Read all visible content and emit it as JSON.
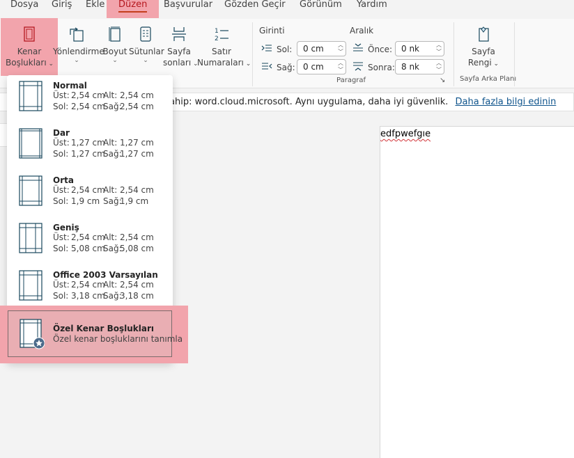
{
  "menu": {
    "items": [
      "Dosya",
      "Giriş",
      "Ekle",
      "Düzen",
      "Başvurular",
      "Gözden Geçir",
      "Görünüm",
      "Yardım"
    ],
    "active": "Düzen"
  },
  "ribbon": {
    "margins_label_1": "Kenar",
    "margins_label_2": "Boşlukları",
    "orientation_label": "Yönlendirme",
    "size_label": "Boyut",
    "columns_label": "Sütunlar",
    "breaks_label_1": "Sayfa",
    "breaks_label_2": "sonları",
    "linenum_label_1": "Satır",
    "linenum_label_2": "Numaraları",
    "indent_header": "Girinti",
    "spacing_header": "Aralık",
    "indent_left_label": "Sol:",
    "indent_left_value": "0 cm",
    "indent_right_label": "Sağ:",
    "indent_right_value": "0 cm",
    "space_before_label": "Önce:",
    "space_before_value": "0 nk",
    "space_after_label": "Sonra:",
    "space_after_value": "8 nk",
    "paragraph_group": "Paragraf",
    "page_color_label_1": "Sayfa",
    "page_color_label_2": "Rengi",
    "page_background_group": "Sayfa Arka Planı"
  },
  "notification": {
    "text": "ahip: word.cloud.microsoft. Aynı uygulama, daha iyi güvenlik.",
    "link": "Daha fazla bilgi edinin"
  },
  "document": {
    "text": "edfpwefgıe"
  },
  "margins_menu": {
    "presets": [
      {
        "name": "Normal",
        "top_label": "Üst:",
        "top": "2,54 cm",
        "bottom_label": "Alt:",
        "bottom": "2,54 cm",
        "left_label": "Sol:",
        "left": "2,54 cm",
        "right_label": "Sağ:",
        "right": "2,54 cm"
      },
      {
        "name": "Dar",
        "top_label": "Üst:",
        "top": "1,27 cm",
        "bottom_label": "Alt:",
        "bottom": "1,27 cm",
        "left_label": "Sol:",
        "left": "1,27 cm",
        "right_label": "Sağ:",
        "right": "1,27 cm"
      },
      {
        "name": "Orta",
        "top_label": "Üst:",
        "top": "2,54 cm",
        "bottom_label": "Alt:",
        "bottom": "2,54 cm",
        "left_label": "Sol:",
        "left": "1,9 cm",
        "right_label": "Sağ:",
        "right": "1,9 cm"
      },
      {
        "name": "Geniş",
        "top_label": "Üst:",
        "top": "2,54 cm",
        "bottom_label": "Alt:",
        "bottom": "2,54 cm",
        "left_label": "Sol:",
        "left": "5,08 cm",
        "right_label": "Sağ:",
        "right": "5,08 cm"
      },
      {
        "name": "Office 2003 Varsayılan",
        "top_label": "Üst:",
        "top": "2,54 cm",
        "bottom_label": "Alt:",
        "bottom": "2,54 cm",
        "left_label": "Sol:",
        "left": "3,18 cm",
        "right_label": "Sağ:",
        "right": "3,18 cm"
      }
    ],
    "custom_name": "Özel Kenar Boşlukları",
    "custom_desc": "Özel kenar boşluklarını tanımla"
  },
  "colors": {
    "highlight": "#f2a4ac",
    "active_tab_text": "#b5171e",
    "link": "#0f548c",
    "page_icon": "#17465c"
  }
}
